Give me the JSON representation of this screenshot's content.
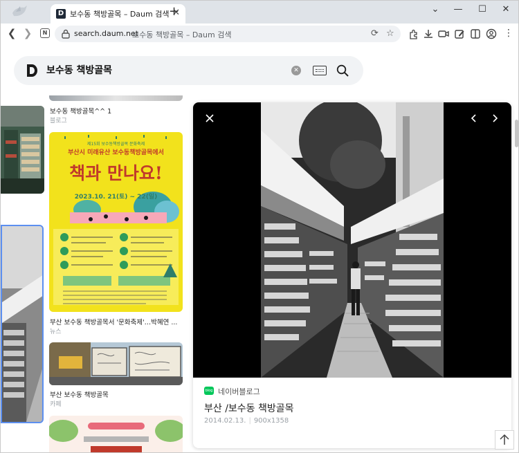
{
  "browser": {
    "tab_title": "보수동 책방골목 – Daum 검색",
    "tab_favicon_letter": "D",
    "new_tab_symbol": "+",
    "url_host": "search.daum.net",
    "url_title": "보수동 책방골목 – Daum 검색",
    "n_icon_letter": "N"
  },
  "search": {
    "logo_letter": "D",
    "query": "보수동 책방골목"
  },
  "results": [
    {
      "caption": "보수동 책방골목^^ 1",
      "source": "블로그"
    },
    {
      "caption": "부산 보수동 책방골목서 '문화축제'…박혜연 ...",
      "source": "뉴스"
    },
    {
      "caption": "부산 보수동 책방골목",
      "source": "카페"
    }
  ],
  "poster": {
    "top_line": "제15회 보수동책방골목 문화축제",
    "headline": "부산시 미래유산 보수동책방골목에서",
    "big": "책과 만나요!",
    "date": "2023.10. 21(토) ~ 22(일)"
  },
  "viewer": {
    "source": "네이버블로그",
    "source_badge": "blog",
    "title": "부산 /보수동 책방골목",
    "date": "2014.02.13.",
    "size": "900x1358"
  },
  "colors": {
    "accent_blog": "#03c75a",
    "poster_yellow": "#f2e21c"
  }
}
